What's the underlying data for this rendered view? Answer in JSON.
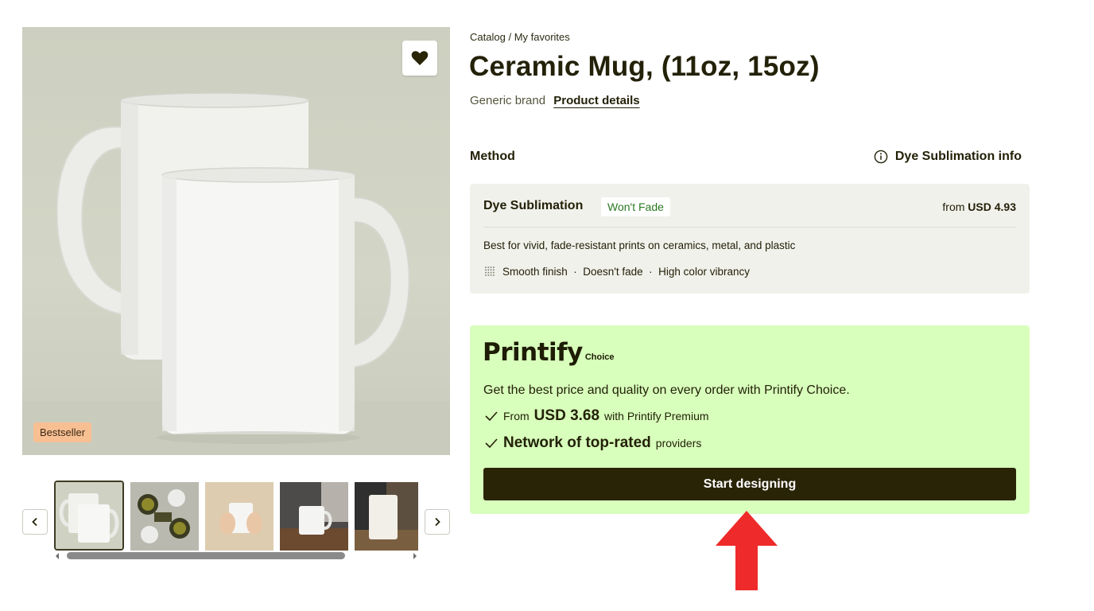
{
  "breadcrumb": {
    "catalog": "Catalog",
    "separator": "/",
    "current": "My favorites"
  },
  "product": {
    "title": "Ceramic Mug, (11oz, 15oz)",
    "brand": "Generic brand",
    "details_link": "Product details"
  },
  "gallery": {
    "badge": "Bestseller",
    "favorite_icon": "heart-icon",
    "prev_icon": "chevron-left-icon",
    "next_icon": "chevron-right-icon",
    "selected_index": 0,
    "thumbnail_count": 5
  },
  "method": {
    "label": "Method",
    "info_link": "Dye Sublimation info",
    "info_icon": "info-icon",
    "card": {
      "name": "Dye Sublimation",
      "badge": "Won't Fade",
      "price_prefix": "from",
      "price": "USD 4.93",
      "description": "Best for vivid, fade-resistant prints on ceramics, metal, and plastic",
      "features": "Smooth finish  ·  Doesn't fade  ·  High color vibrancy",
      "features_icon": "dotted-grid-icon"
    }
  },
  "choice": {
    "logo_text": "Printify",
    "logo_sub": "Choice",
    "description": "Get the best price and quality on every order with Printify Choice.",
    "row1": {
      "prefix": "From",
      "highlight": "USD 3.68",
      "suffix": "with Printify Premium"
    },
    "row2": {
      "highlight": "Network of top-rated",
      "suffix": "providers"
    },
    "cta": "Start designing"
  },
  "colors": {
    "text_dark": "#232108",
    "choice_bg": "#d8ffbc",
    "cta_bg": "#2a2407",
    "method_card_bg": "#f1f1ec",
    "badge_green": "#2a7a22",
    "bestseller_bg": "#f8bf92",
    "annotation_arrow": "#ee2a2a"
  }
}
